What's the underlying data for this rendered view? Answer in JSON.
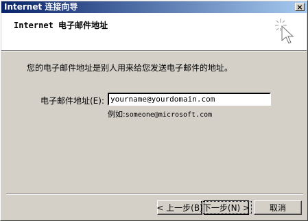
{
  "window": {
    "title": "Internet 连接向导",
    "close_glyph": "×"
  },
  "header": {
    "title": "Internet 电子邮件地址",
    "icon": "wizard-wand-icon"
  },
  "main": {
    "intro": "您的电子邮件地址是别人用来给您发送电子邮件的地址。",
    "email_label": "电子邮件地址(E):",
    "email_value": "yourname@yourdomain.com",
    "example_prefix": "例如:",
    "example_value": "someone@microsoft.com"
  },
  "buttons": {
    "back": "< 上一步(B)",
    "next": "下一步(N) >",
    "cancel": "取消"
  }
}
